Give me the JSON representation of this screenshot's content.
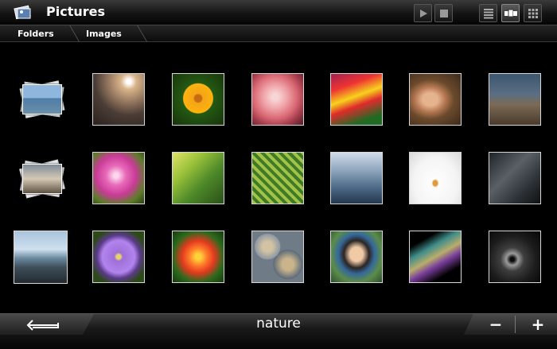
{
  "app": {
    "title": "Pictures"
  },
  "tabs": [
    {
      "label": "Folders"
    },
    {
      "label": "Images"
    }
  ],
  "toolbar": {
    "play_icon": "play-icon",
    "stop_icon": "stop-icon",
    "view_list_icon": "list-view-icon",
    "view_flow_icon": "flow-view-icon",
    "view_grid_icon": "grid-view-icon"
  },
  "grid": {
    "rows": [
      [
        "folder-stack",
        "sunset-lake",
        "yellow-flower",
        "pink-rose",
        "tulip-art",
        "smiling-man",
        "camel-street"
      ],
      [
        "folder-stack",
        "pink-dianthus",
        "green-leaf",
        "fern-frond",
        "water-surface",
        "balloon-figure",
        "abstract-grey"
      ],
      [
        "seaside-rocks",
        "purple-daisy",
        "red-rose",
        "pebbles",
        "girl-portrait",
        "terrain-3d",
        "hurricane"
      ]
    ]
  },
  "bottom": {
    "album_name": "nature",
    "back_icon": "back-arrow-icon",
    "zoom_out": "−",
    "zoom_in": "+"
  }
}
